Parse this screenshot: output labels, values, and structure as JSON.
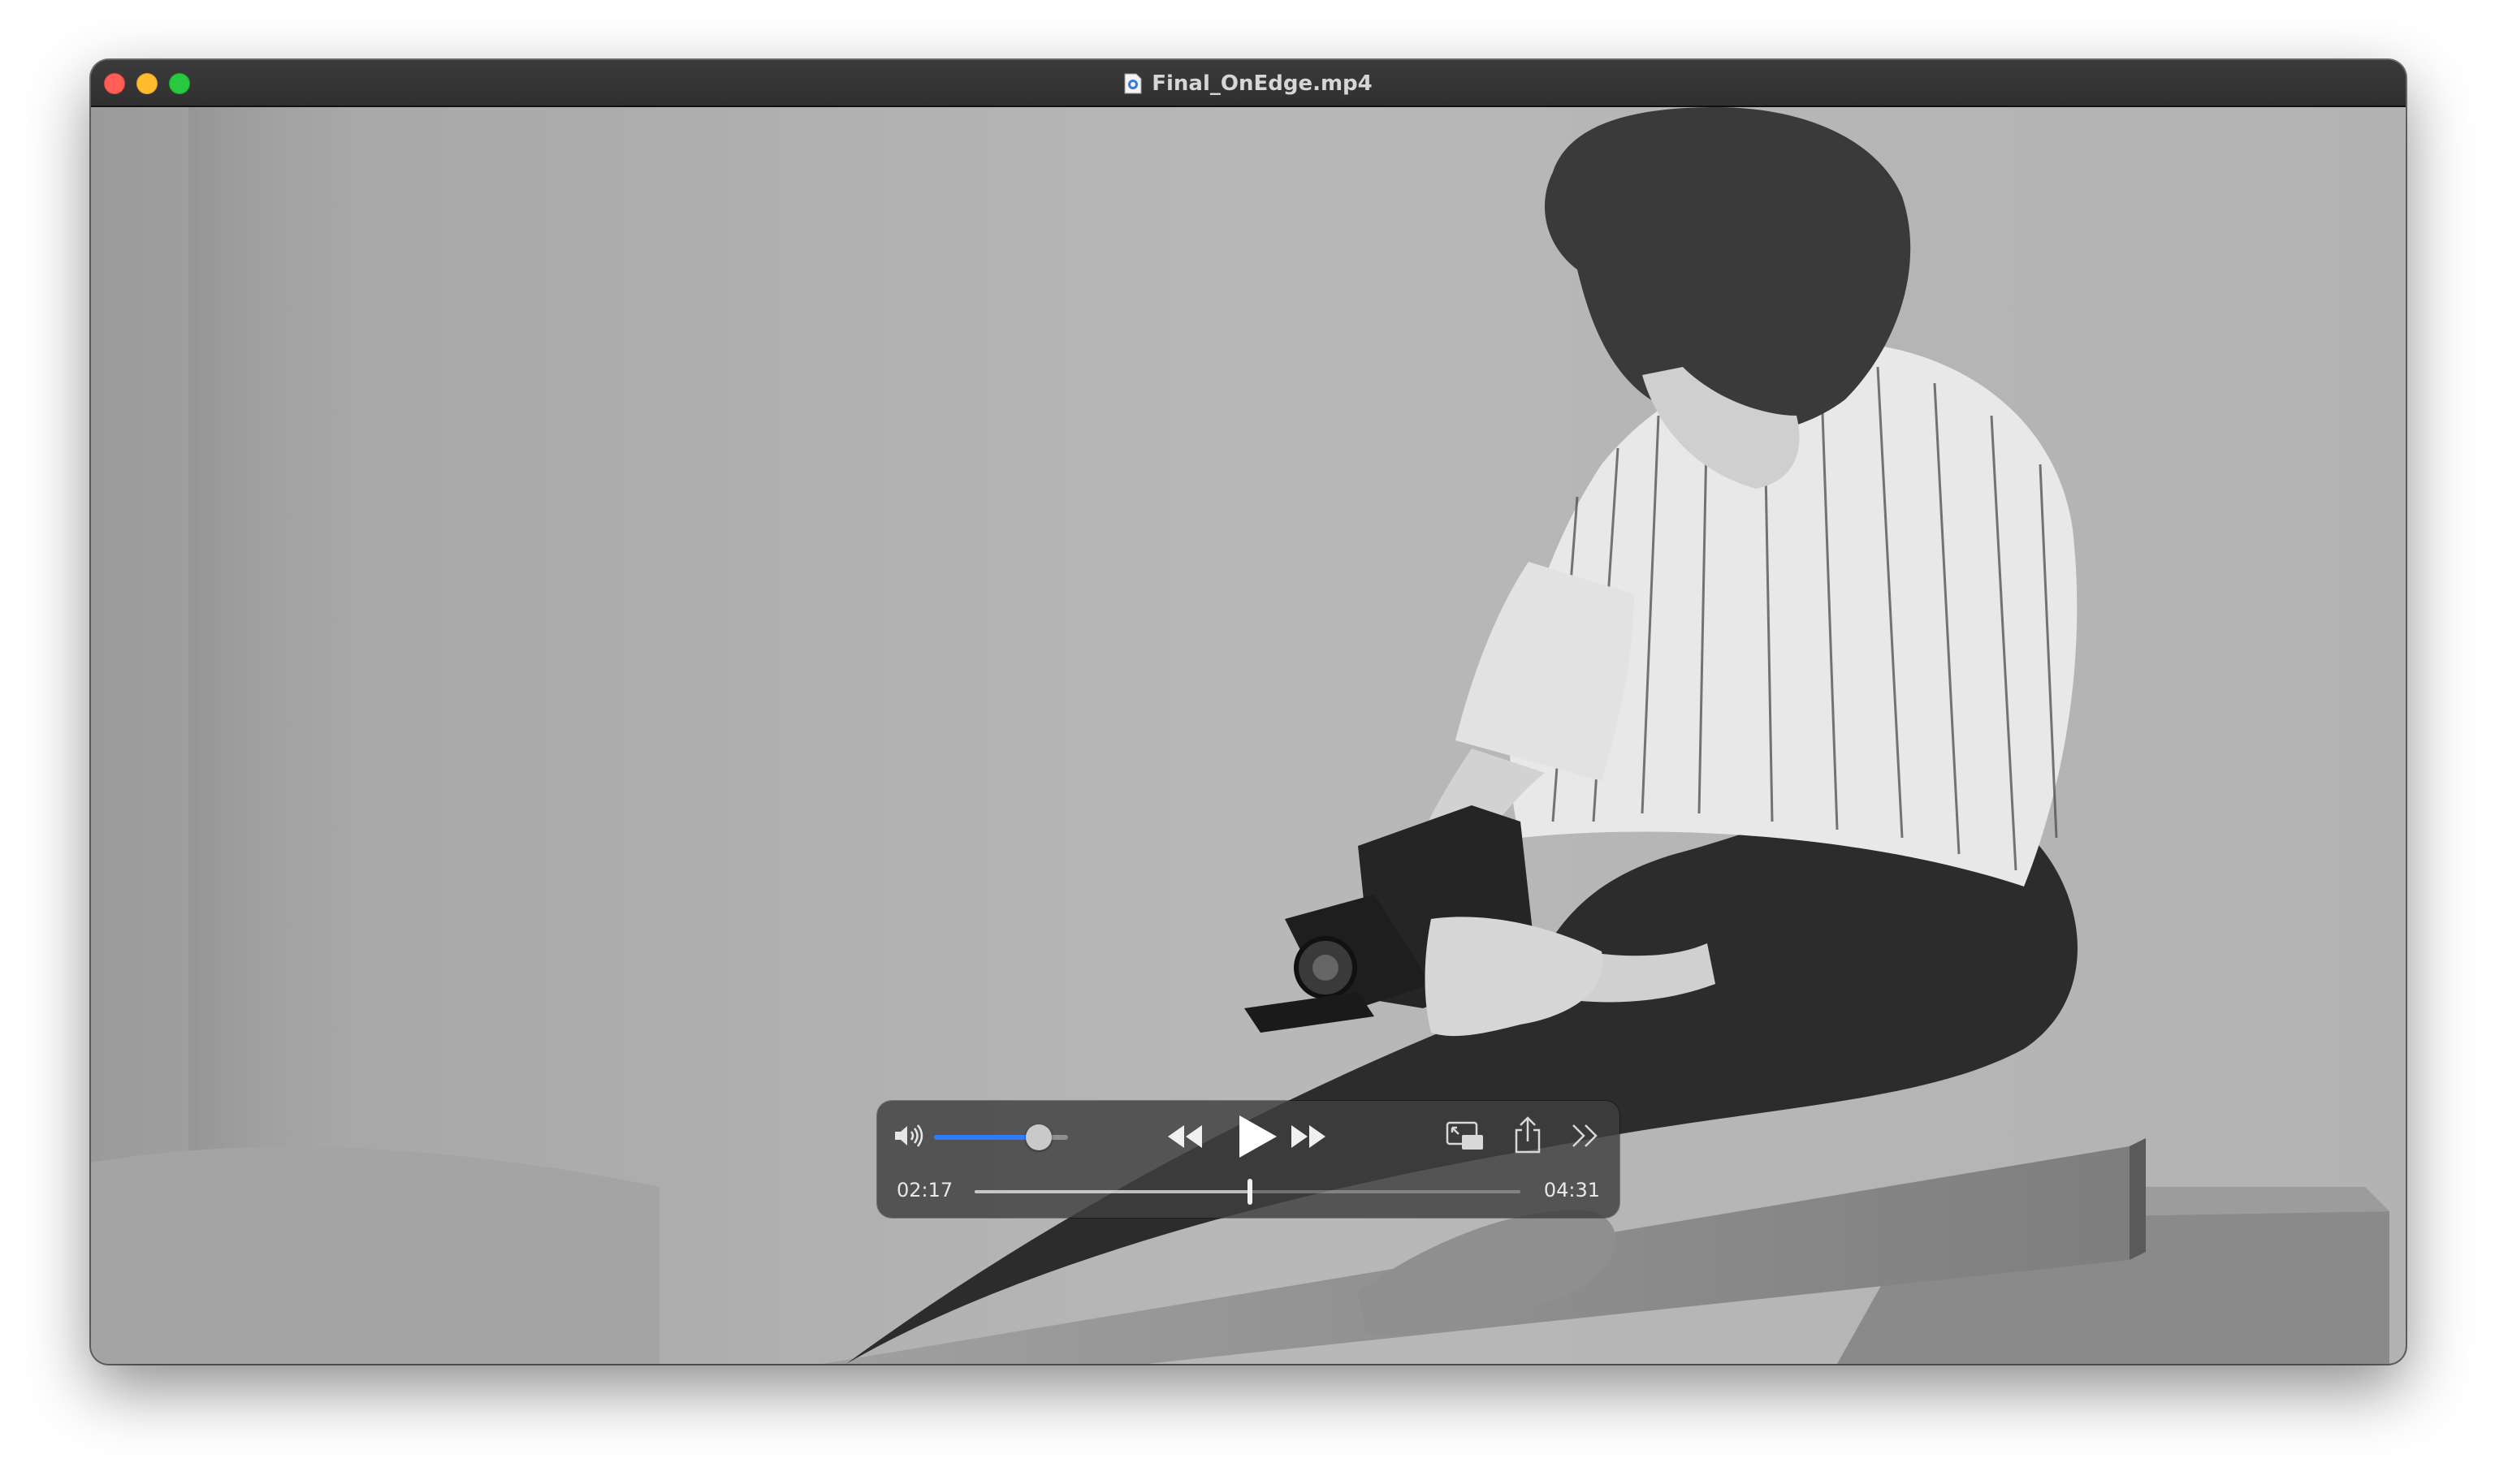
{
  "window": {
    "title": "Final_OnEdge.mp4",
    "traffic_lights": {
      "close": "#ff5f57",
      "minimize": "#febc2e",
      "zoom": "#28c840"
    },
    "title_icon": "quicktime-document-icon"
  },
  "video": {
    "content": "black-and-white photo",
    "playing": false
  },
  "controls": {
    "volume_level": 0.78,
    "volume_color": "#2f7cf6",
    "current_time": "02:17",
    "total_time": "04:31",
    "progress": 0.505,
    "icons": [
      "volume-icon",
      "rewind-icon",
      "play-icon",
      "fast-forward-icon",
      "picture-in-picture-icon",
      "share-icon",
      "more-icon"
    ]
  }
}
